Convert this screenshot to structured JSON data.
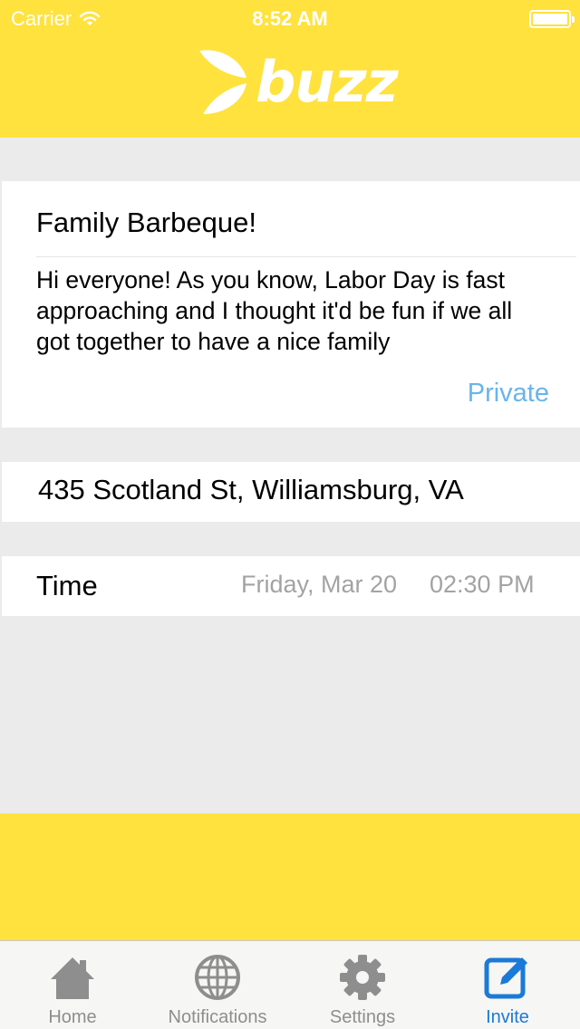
{
  "status_bar": {
    "carrier": "Carrier",
    "time": "8:52 AM",
    "icons": [
      "wifi-icon",
      "battery-icon"
    ]
  },
  "header": {
    "logo_text": "buzz",
    "background_color": "#ffe23d"
  },
  "event": {
    "title": "Family Barbeque!",
    "description": "Hi everyone! As you know, Labor Day is fast approaching and I thought it'd be fun if we all got together to have a nice family",
    "privacy": "Private"
  },
  "location": {
    "address": "435 Scotland St, Williamsburg, VA"
  },
  "time": {
    "label": "Time",
    "date": "Friday, Mar 20",
    "clock": "02:30 PM"
  },
  "tab_bar": {
    "tabs": [
      {
        "label": "Home",
        "icon": "home-icon",
        "active": false
      },
      {
        "label": "Notifications",
        "icon": "globe-icon",
        "active": false
      },
      {
        "label": "Settings",
        "icon": "gear-icon",
        "active": false
      },
      {
        "label": "Invite",
        "icon": "compose-icon",
        "active": true
      }
    ],
    "active_color": "#1b7ad7",
    "inactive_color": "#8e8e8e"
  }
}
